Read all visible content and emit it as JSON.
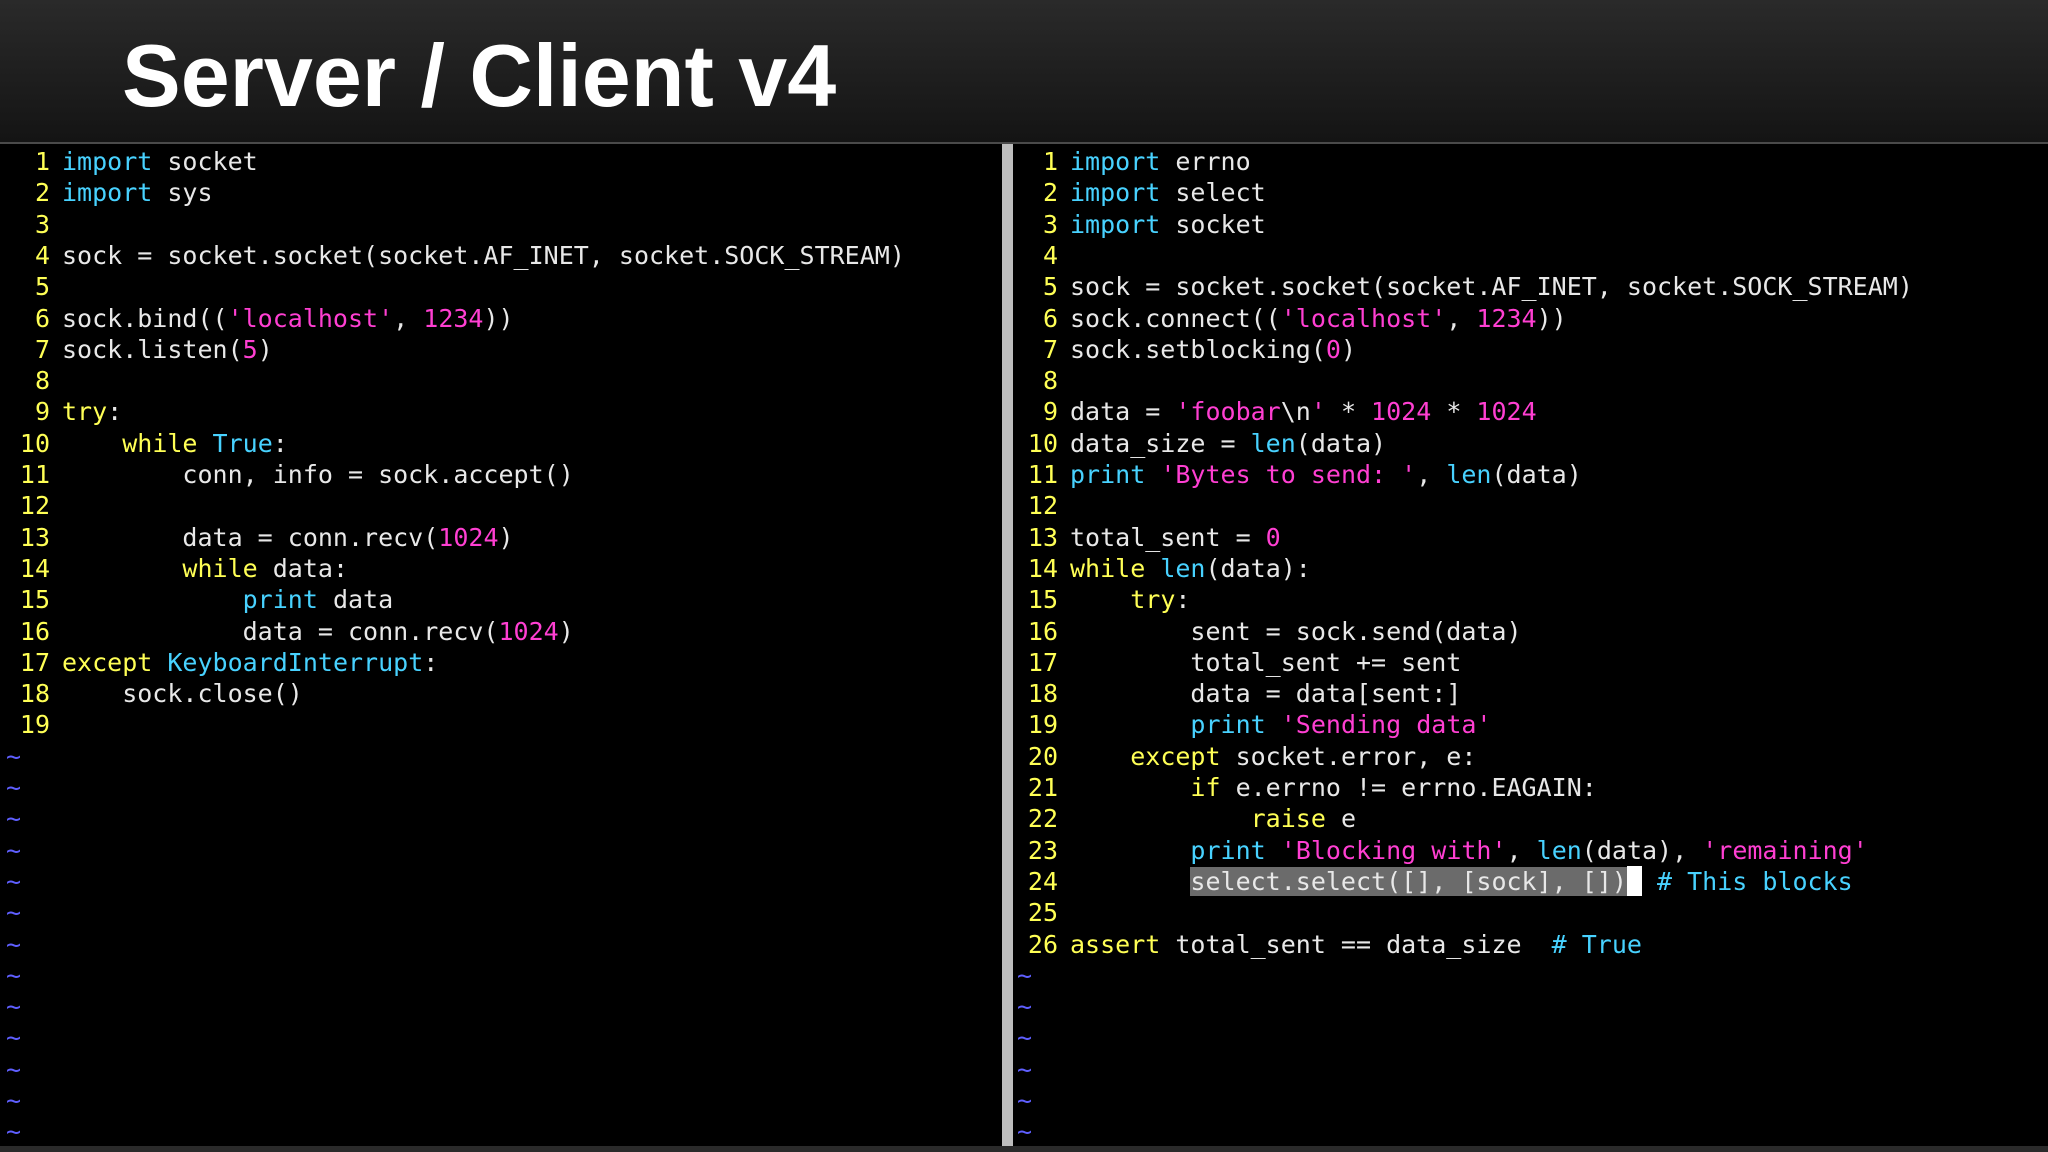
{
  "slide": {
    "title": "Server / Client v4"
  },
  "colors": {
    "keyword_cyan": "#48d2ff",
    "keyword_yellow": "#ffff55",
    "string": "#ff3fd2",
    "number": "#ff3fd2",
    "line_number": "#ffff55",
    "tilde": "#5f5fff",
    "plain_text": "#e8e8e8",
    "visual_selection": "#6b6b6b",
    "split_bar": "#bdbdbd"
  },
  "left_pane": {
    "lines": [
      {
        "num": "1",
        "tokens": [
          {
            "t": "import",
            "c": "kw-cyan"
          },
          {
            "t": " socket"
          }
        ]
      },
      {
        "num": "2",
        "tokens": [
          {
            "t": "import",
            "c": "kw-cyan"
          },
          {
            "t": " sys"
          }
        ]
      },
      {
        "num": "3",
        "tokens": []
      },
      {
        "num": "4",
        "tokens": [
          {
            "t": "sock = socket.socket(socket.AF_INET, socket.SOCK_STREAM)"
          }
        ]
      },
      {
        "num": "5",
        "tokens": []
      },
      {
        "num": "6",
        "tokens": [
          {
            "t": "sock.bind(("
          },
          {
            "t": "'localhost'",
            "c": "str"
          },
          {
            "t": ", "
          },
          {
            "t": "1234",
            "c": "num"
          },
          {
            "t": "))"
          }
        ]
      },
      {
        "num": "7",
        "tokens": [
          {
            "t": "sock.listen("
          },
          {
            "t": "5",
            "c": "num"
          },
          {
            "t": ")"
          }
        ]
      },
      {
        "num": "8",
        "tokens": []
      },
      {
        "num": "9",
        "tokens": [
          {
            "t": "try",
            "c": "kw-yellow"
          },
          {
            "t": ":"
          }
        ]
      },
      {
        "num": "10",
        "tokens": [
          {
            "t": "    "
          },
          {
            "t": "while",
            "c": "kw-yellow"
          },
          {
            "t": " "
          },
          {
            "t": "True",
            "c": "kw-cyan"
          },
          {
            "t": ":"
          }
        ]
      },
      {
        "num": "11",
        "tokens": [
          {
            "t": "        conn, info = sock.accept()"
          }
        ]
      },
      {
        "num": "12",
        "tokens": []
      },
      {
        "num": "13",
        "tokens": [
          {
            "t": "        data = conn.recv("
          },
          {
            "t": "1024",
            "c": "num"
          },
          {
            "t": ")"
          }
        ]
      },
      {
        "num": "14",
        "tokens": [
          {
            "t": "        "
          },
          {
            "t": "while",
            "c": "kw-yellow"
          },
          {
            "t": " data:"
          }
        ]
      },
      {
        "num": "15",
        "tokens": [
          {
            "t": "            "
          },
          {
            "t": "print",
            "c": "kw-cyan"
          },
          {
            "t": " data"
          }
        ]
      },
      {
        "num": "16",
        "tokens": [
          {
            "t": "            data = conn.recv("
          },
          {
            "t": "1024",
            "c": "num"
          },
          {
            "t": ")"
          }
        ]
      },
      {
        "num": "17",
        "tokens": [
          {
            "t": "except",
            "c": "kw-yellow"
          },
          {
            "t": " "
          },
          {
            "t": "KeyboardInterrupt",
            "c": "kw-cyan"
          },
          {
            "t": ":"
          }
        ]
      },
      {
        "num": "18",
        "tokens": [
          {
            "t": "    sock.close()"
          }
        ]
      },
      {
        "num": "19",
        "tokens": []
      }
    ],
    "tildes": [
      "~",
      "~",
      "~",
      "~",
      "~",
      "~",
      "~",
      "~",
      "~",
      "~",
      "~",
      "~",
      "~"
    ]
  },
  "right_pane": {
    "lines": [
      {
        "num": "1",
        "tokens": [
          {
            "t": "import",
            "c": "kw-cyan"
          },
          {
            "t": " errno"
          }
        ]
      },
      {
        "num": "2",
        "tokens": [
          {
            "t": "import",
            "c": "kw-cyan"
          },
          {
            "t": " select"
          }
        ]
      },
      {
        "num": "3",
        "tokens": [
          {
            "t": "import",
            "c": "kw-cyan"
          },
          {
            "t": " socket"
          }
        ]
      },
      {
        "num": "4",
        "tokens": []
      },
      {
        "num": "5",
        "tokens": [
          {
            "t": "sock = socket.socket(socket.AF_INET, socket.SOCK_STREAM)"
          }
        ]
      },
      {
        "num": "6",
        "tokens": [
          {
            "t": "sock.connect(("
          },
          {
            "t": "'localhost'",
            "c": "str"
          },
          {
            "t": ", "
          },
          {
            "t": "1234",
            "c": "num"
          },
          {
            "t": "))"
          }
        ]
      },
      {
        "num": "7",
        "tokens": [
          {
            "t": "sock.setblocking("
          },
          {
            "t": "0",
            "c": "num"
          },
          {
            "t": ")"
          }
        ]
      },
      {
        "num": "8",
        "tokens": []
      },
      {
        "num": "9",
        "tokens": [
          {
            "t": "data = "
          },
          {
            "t": "'foobar",
            "c": "str"
          },
          {
            "t": "\\n"
          },
          {
            "t": "'",
            "c": "str"
          },
          {
            "t": " * "
          },
          {
            "t": "1024",
            "c": "num"
          },
          {
            "t": " * "
          },
          {
            "t": "1024",
            "c": "num"
          }
        ]
      },
      {
        "num": "10",
        "tokens": [
          {
            "t": "data_size = "
          },
          {
            "t": "len",
            "c": "kw-cyan"
          },
          {
            "t": "(data)"
          }
        ]
      },
      {
        "num": "11",
        "tokens": [
          {
            "t": "print",
            "c": "kw-cyan"
          },
          {
            "t": " "
          },
          {
            "t": "'Bytes to send: '",
            "c": "str"
          },
          {
            "t": ", "
          },
          {
            "t": "len",
            "c": "kw-cyan"
          },
          {
            "t": "(data)"
          }
        ]
      },
      {
        "num": "12",
        "tokens": []
      },
      {
        "num": "13",
        "tokens": [
          {
            "t": "total_sent = "
          },
          {
            "t": "0",
            "c": "num"
          }
        ]
      },
      {
        "num": "14",
        "tokens": [
          {
            "t": "while",
            "c": "kw-yellow"
          },
          {
            "t": " "
          },
          {
            "t": "len",
            "c": "kw-cyan"
          },
          {
            "t": "(data):"
          }
        ]
      },
      {
        "num": "15",
        "tokens": [
          {
            "t": "    "
          },
          {
            "t": "try",
            "c": "kw-yellow"
          },
          {
            "t": ":"
          }
        ]
      },
      {
        "num": "16",
        "tokens": [
          {
            "t": "        sent = sock.send(data)"
          }
        ]
      },
      {
        "num": "17",
        "tokens": [
          {
            "t": "        total_sent += sent"
          }
        ]
      },
      {
        "num": "18",
        "tokens": [
          {
            "t": "        data = data[sent:]"
          }
        ]
      },
      {
        "num": "19",
        "tokens": [
          {
            "t": "        "
          },
          {
            "t": "print",
            "c": "kw-cyan"
          },
          {
            "t": " "
          },
          {
            "t": "'Sending data'",
            "c": "str"
          }
        ]
      },
      {
        "num": "20",
        "tokens": [
          {
            "t": "    "
          },
          {
            "t": "except",
            "c": "kw-yellow"
          },
          {
            "t": " socket.error, e:"
          }
        ]
      },
      {
        "num": "21",
        "tokens": [
          {
            "t": "        "
          },
          {
            "t": "if",
            "c": "kw-yellow"
          },
          {
            "t": " e.errno != errno.EAGAIN:"
          }
        ]
      },
      {
        "num": "22",
        "tokens": [
          {
            "t": "            "
          },
          {
            "t": "raise",
            "c": "kw-yellow"
          },
          {
            "t": " e"
          }
        ]
      },
      {
        "num": "23",
        "tokens": [
          {
            "t": "        "
          },
          {
            "t": "print",
            "c": "kw-cyan"
          },
          {
            "t": " "
          },
          {
            "t": "'Blocking with'",
            "c": "str"
          },
          {
            "t": ", "
          },
          {
            "t": "len",
            "c": "kw-cyan"
          },
          {
            "t": "(data), "
          },
          {
            "t": "'remaining'",
            "c": "str"
          }
        ]
      },
      {
        "num": "24",
        "tokens": [
          {
            "t": "        "
          },
          {
            "t": "select.select([], [sock], [])",
            "c": "visual"
          },
          {
            "t": "",
            "c": "cursor"
          },
          {
            "t": " "
          },
          {
            "t": "# This blocks",
            "c": "com"
          }
        ]
      },
      {
        "num": "25",
        "tokens": []
      },
      {
        "num": "26",
        "tokens": [
          {
            "t": "assert",
            "c": "kw-yellow"
          },
          {
            "t": " total_sent == data_size  "
          },
          {
            "t": "# True",
            "c": "com"
          }
        ]
      }
    ],
    "tildes": [
      "~",
      "~",
      "~",
      "~",
      "~",
      "~"
    ]
  }
}
